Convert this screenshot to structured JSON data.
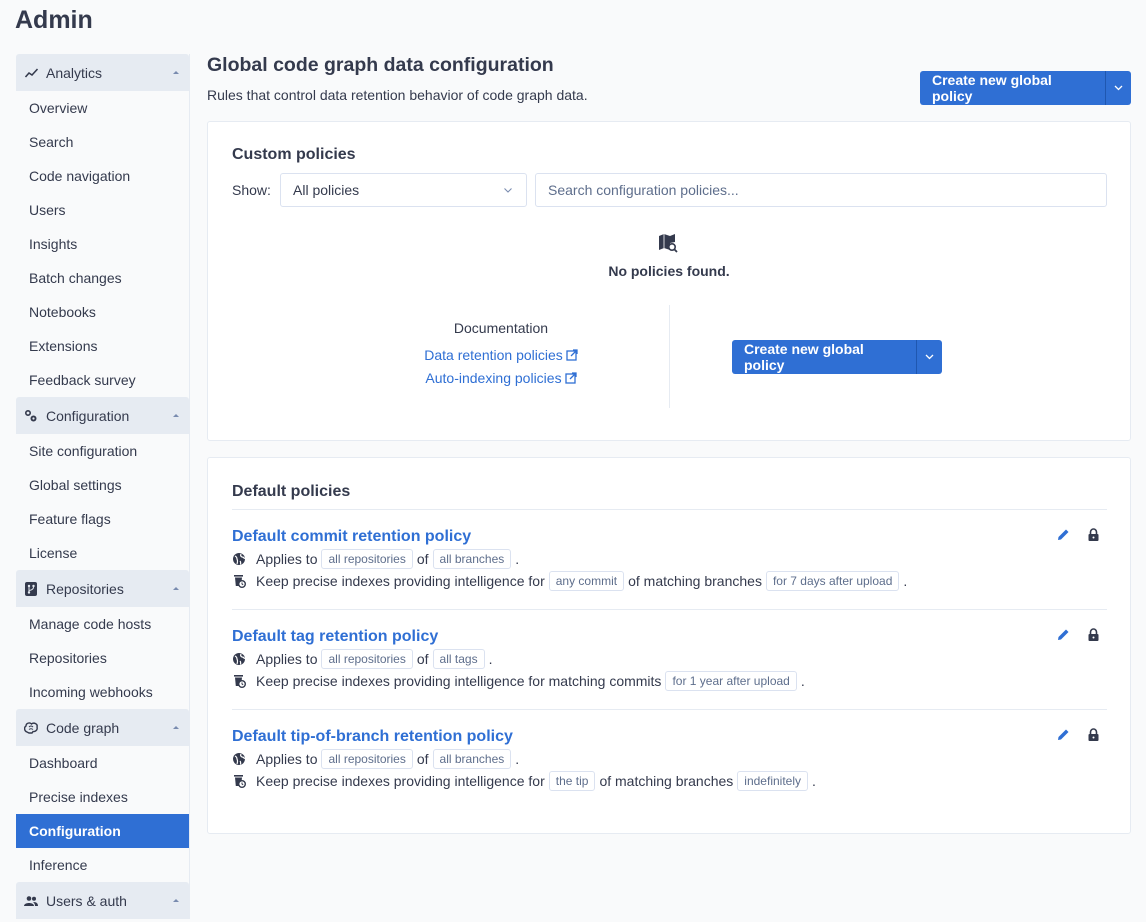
{
  "app": {
    "title": "Admin"
  },
  "sidebar": {
    "groups": [
      {
        "label": "Analytics",
        "icon": "chart-line-icon",
        "items": [
          "Overview",
          "Search",
          "Code navigation",
          "Users",
          "Insights",
          "Batch changes",
          "Notebooks",
          "Extensions",
          "Feedback survey"
        ]
      },
      {
        "label": "Configuration",
        "icon": "cogs-icon",
        "items": [
          "Site configuration",
          "Global settings",
          "Feature flags",
          "License"
        ]
      },
      {
        "label": "Repositories",
        "icon": "source-repository-icon",
        "items": [
          "Manage code hosts",
          "Repositories",
          "Incoming webhooks"
        ]
      },
      {
        "label": "Code graph",
        "icon": "brain-icon",
        "items": [
          "Dashboard",
          "Precise indexes",
          "Configuration",
          "Inference"
        ],
        "active_item": "Configuration"
      },
      {
        "label": "Users & auth",
        "icon": "users-icon",
        "items": []
      }
    ]
  },
  "main": {
    "title": "Global code graph data configuration",
    "subtitle": "Rules that control data retention behavior of code graph data.",
    "create_button_label": "Create new global policy",
    "custom": {
      "title": "Custom policies",
      "show_label": "Show:",
      "filter_value": "All policies",
      "search_placeholder": "Search configuration policies...",
      "empty_text": "No policies found.",
      "doc_title": "Documentation",
      "doc_links": [
        "Data retention policies",
        "Auto-indexing policies"
      ],
      "create_button_label": "Create new global policy"
    },
    "default": {
      "title": "Default policies",
      "policies": [
        {
          "name": "Default commit retention policy",
          "applies_prefix": "Applies to",
          "repos": "all repositories",
          "of": "of",
          "target": "all branches",
          "period": ".",
          "keep_prefix": "Keep precise indexes providing intelligence for",
          "keep_badge1": "any commit",
          "keep_middle": "of matching branches",
          "keep_badge2": "for 7 days after upload",
          "keep_end": "."
        },
        {
          "name": "Default tag retention policy",
          "applies_prefix": "Applies to",
          "repos": "all repositories",
          "of": "of",
          "target": "all tags",
          "period": ".",
          "keep_prefix": "Keep precise indexes providing intelligence for matching commits",
          "keep_badge2": "for 1 year after upload",
          "keep_end": "."
        },
        {
          "name": "Default tip-of-branch retention policy",
          "applies_prefix": "Applies to",
          "repos": "all repositories",
          "of": "of",
          "target": "all branches",
          "period": ".",
          "keep_prefix": "Keep precise indexes providing intelligence for",
          "keep_badge1": "the tip",
          "keep_middle": "of matching branches",
          "keep_badge2": "indefinitely",
          "keep_end": "."
        }
      ]
    }
  },
  "colors": {
    "accent": "#2f6fd4",
    "text": "#343a4d",
    "muted": "#5e6e8c",
    "sidebar_header": "#e6ebf2"
  }
}
